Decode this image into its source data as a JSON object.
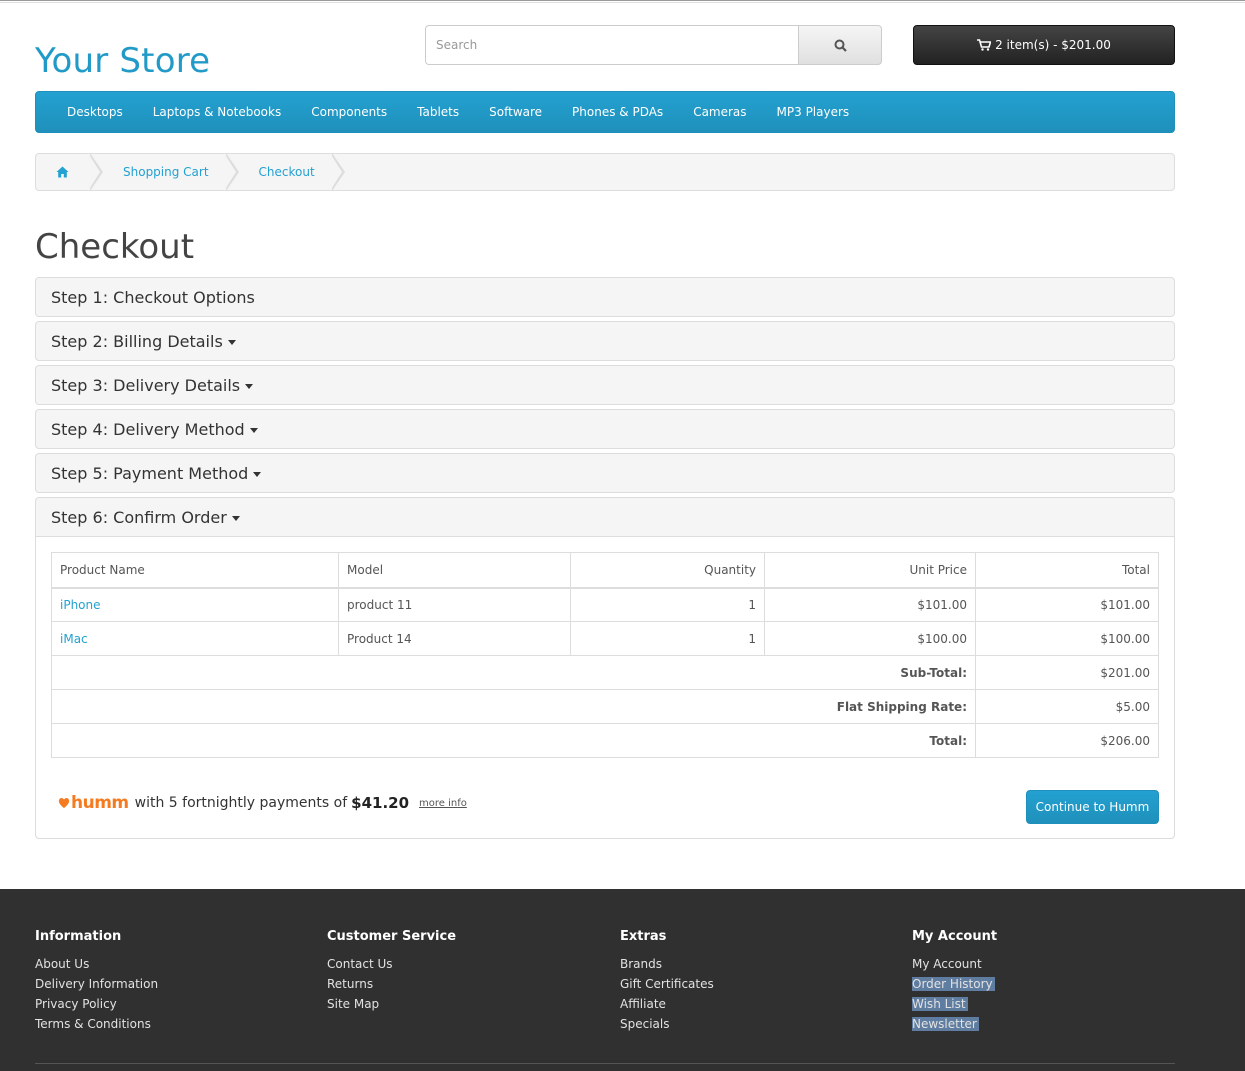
{
  "header": {
    "logo": "Your Store",
    "search": {
      "placeholder": "Search"
    },
    "cart_label": "2 item(s) - $201.00"
  },
  "menu": [
    "Desktops",
    "Laptops & Notebooks",
    "Components",
    "Tablets",
    "Software",
    "Phones & PDAs",
    "Cameras",
    "MP3 Players"
  ],
  "breadcrumb": [
    "Shopping Cart",
    "Checkout"
  ],
  "page_title": "Checkout",
  "steps": [
    "Step 1: Checkout Options",
    "Step 2: Billing Details",
    "Step 3: Delivery Details",
    "Step 4: Delivery Method",
    "Step 5: Payment Method",
    "Step 6: Confirm Order"
  ],
  "order_table": {
    "columns": [
      "Product Name",
      "Model",
      "Quantity",
      "Unit Price",
      "Total"
    ],
    "rows": [
      {
        "name": "iPhone",
        "model": "product 11",
        "qty": "1",
        "unit": "$101.00",
        "total": "$101.00"
      },
      {
        "name": "iMac",
        "model": "Product 14",
        "qty": "1",
        "unit": "$100.00",
        "total": "$100.00"
      }
    ],
    "totals": [
      {
        "label": "Sub-Total:",
        "value": "$201.00"
      },
      {
        "label": "Flat Shipping Rate:",
        "value": "$5.00"
      },
      {
        "label": "Total:",
        "value": "$206.00"
      }
    ]
  },
  "humm": {
    "logo": "humm",
    "text": "with 5 fortnightly payments of",
    "amount": "$41.20",
    "more_info": "more info",
    "button": "Continue to Humm"
  },
  "footer": {
    "information": {
      "title": "Information",
      "links": [
        "About Us",
        "Delivery Information",
        "Privacy Policy",
        "Terms & Conditions"
      ]
    },
    "customer_service": {
      "title": "Customer Service",
      "links": [
        "Contact Us",
        "Returns",
        "Site Map"
      ]
    },
    "extras": {
      "title": "Extras",
      "links": [
        "Brands",
        "Gift Certificates",
        "Affiliate",
        "Specials"
      ]
    },
    "my_account": {
      "title": "My Account",
      "links": [
        "My Account",
        "Order History",
        "Wish List",
        "Newsletter"
      ]
    }
  },
  "colors": {
    "accent": "#229ac8",
    "humm_orange": "#f47b20",
    "footer_bg": "#303030"
  }
}
